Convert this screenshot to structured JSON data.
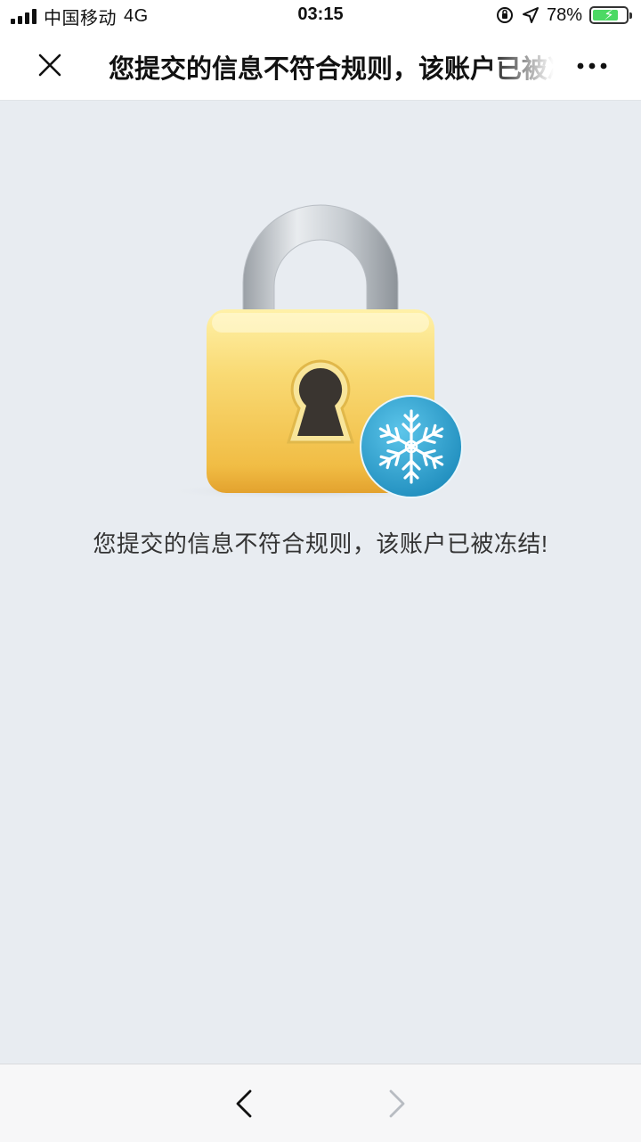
{
  "status_bar": {
    "carrier": "中国移动",
    "network": "4G",
    "time": "03:15",
    "battery_percent": "78%",
    "battery_level": 0.78,
    "charging": true
  },
  "nav": {
    "title": "您提交的信息不符合规则，该账户已被冻结！",
    "close_icon": "close-icon",
    "more_icon": "more-dots-icon"
  },
  "main": {
    "illustration": "frozen-lock-icon",
    "message": "您提交的信息不符合规则，该账户已被冻结!"
  },
  "toolbar": {
    "back_icon": "chevron-left-icon",
    "forward_icon": "chevron-right-icon",
    "forward_enabled": false
  },
  "colors": {
    "background": "#e8ecf1",
    "lock_body": "#f5c955",
    "snow_badge": "#37a9d6",
    "battery_fill": "#4cd964"
  }
}
